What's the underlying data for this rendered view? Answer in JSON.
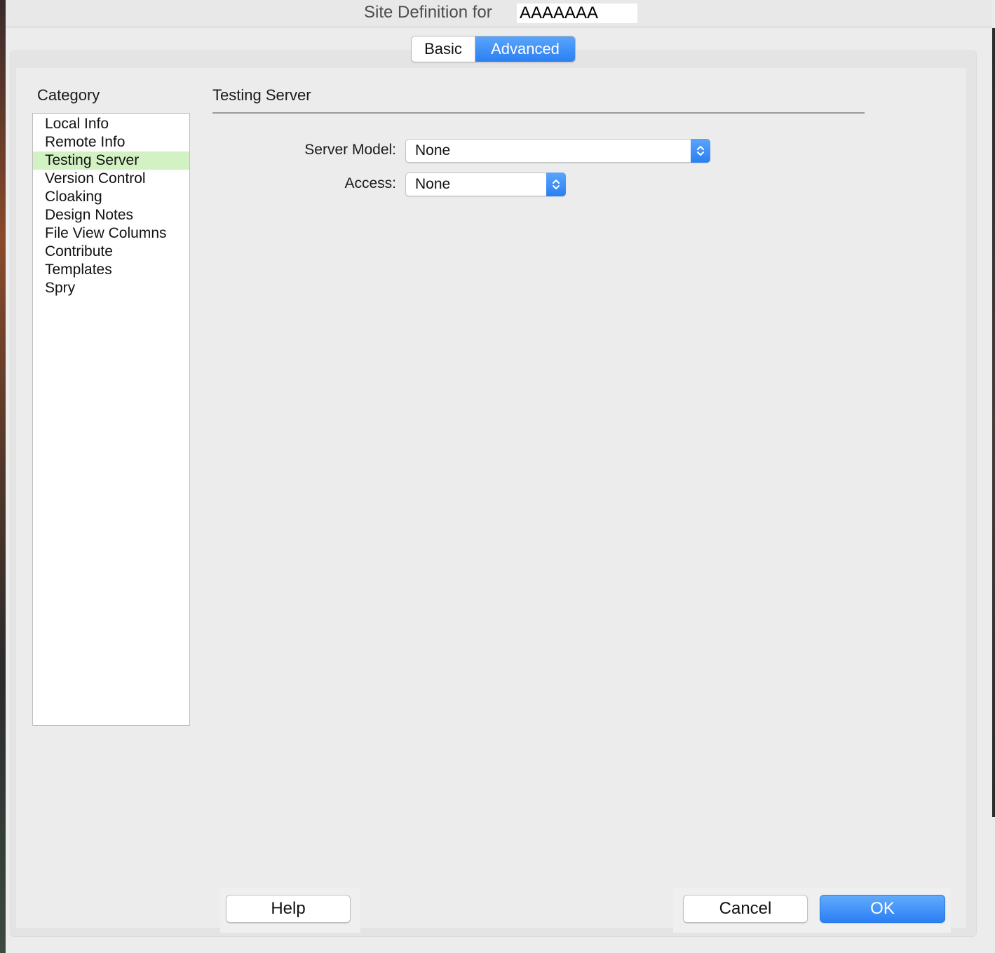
{
  "window": {
    "title_prefix": "Site Definition for",
    "site_name": "AAAAAAA"
  },
  "mode_tabs": {
    "basic": "Basic",
    "advanced": "Advanced",
    "selected": "Advanced"
  },
  "category": {
    "label": "Category",
    "selected": "Testing Server",
    "items": [
      "Local Info",
      "Remote Info",
      "Testing Server",
      "Version Control",
      "Cloaking",
      "Design Notes",
      "File View Columns",
      "Contribute",
      "Templates",
      "Spry"
    ]
  },
  "section": {
    "title": "Testing Server",
    "server_model_label": "Server Model:",
    "server_model_value": "None",
    "access_label": "Access:",
    "access_value": "None"
  },
  "buttons": {
    "help": "Help",
    "cancel": "Cancel",
    "ok": "OK"
  },
  "colors": {
    "accent": "#2b7ff3",
    "selected_row": "#d3f2c4",
    "background": "#ececec"
  }
}
